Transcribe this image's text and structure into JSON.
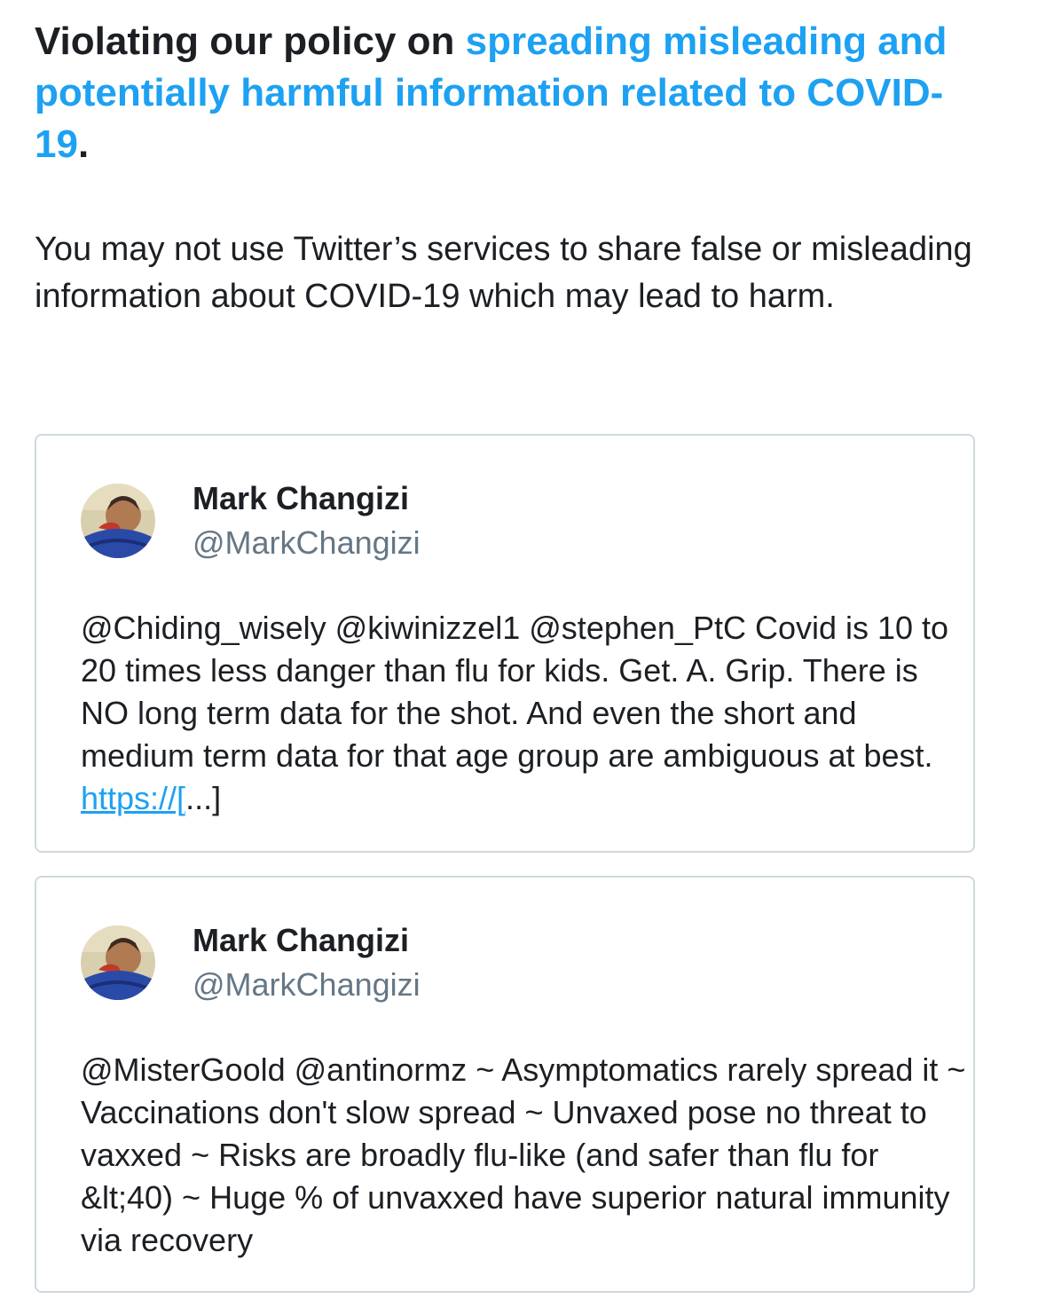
{
  "header": {
    "title_prefix": "Violating our policy on ",
    "title_link": "spreading misleading and potentially harmful information related to COVID-19",
    "title_suffix": "."
  },
  "intro": {
    "text": "You may not use Twitter’s services to share false or misleading information about COVID-19 which may lead to harm."
  },
  "tweets": [
    {
      "author": "Mark Changizi",
      "handle": "@MarkChangizi",
      "avatar_icon": "profile-photo",
      "text": "@Chiding_wisely @kiwinizzel1 @stephen_PtC Covid is 10 to 20 times less danger than flu for kids. Get. A. Grip. There is NO long term data for the shot. And even the short and medium term data for that age group are ambiguous at best. ",
      "link": "https://[",
      "after_link": "...]"
    },
    {
      "author": "Mark Changizi",
      "handle": "@MarkChangizi",
      "avatar_icon": "profile-photo",
      "text": "@MisterGoold @antinormz ~ Asymptomatics rarely spread it ~ Vaccinations don't slow spread ~ Unvaxed pose no threat to vaxxed ~ Risks are broadly flu-like (and safer than flu for &lt;40) ~ Huge % of unvaxxed have superior natural immunity via recovery"
    }
  ],
  "colors": {
    "link": "#1da1f2",
    "text": "#1c1f23",
    "handle": "#657786",
    "card_border": "#cfd9de"
  }
}
